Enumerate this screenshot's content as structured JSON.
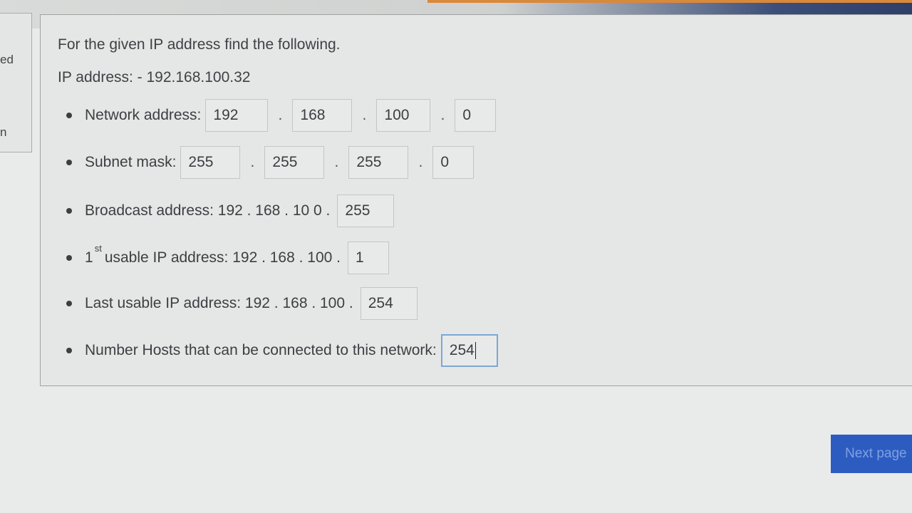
{
  "sidebar": {
    "text_top": "ed",
    "text_bottom": "n"
  },
  "question": {
    "heading": "For the given IP address find the following.",
    "ip_line": "IP address: - 192.168.100.32"
  },
  "network_address": {
    "label": "Network address:",
    "octets": [
      "192",
      "168",
      "100",
      "0"
    ]
  },
  "subnet_mask": {
    "label": "Subnet mask:",
    "octets": [
      "255",
      "255",
      "255",
      "0"
    ]
  },
  "broadcast": {
    "label": "Broadcast address: 192 . 168 . 10 0 .",
    "last_octet": "255"
  },
  "first_usable": {
    "num": "1",
    "sup": "st",
    "label": "usable IP address: 192 . 168 . 100 .",
    "last_octet": "1"
  },
  "last_usable": {
    "label": "Last usable IP address: 192 . 168 . 100 .",
    "last_octet": "254"
  },
  "hosts": {
    "label": "Number Hosts that can be connected to this network:",
    "value": "254"
  },
  "separator": ".",
  "footer": {
    "next_label": "Next page"
  }
}
